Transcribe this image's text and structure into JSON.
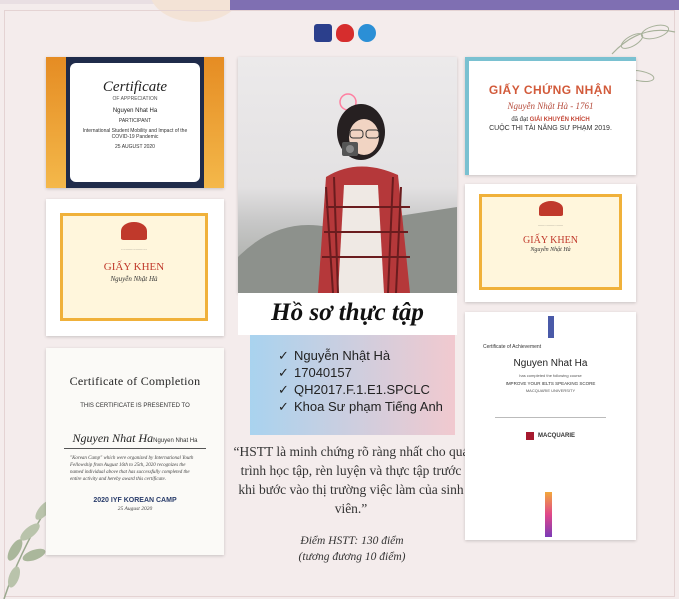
{
  "colors": {
    "accent": "#7f6fb2",
    "page_bg": "#f4ecec",
    "red_text": "#c0392b",
    "border_gold": "#f0b13a"
  },
  "header_logos": [
    "university-logo",
    "youth-union-logo",
    "students-association-logo"
  ],
  "cert_top_left": {
    "title": "Certificate",
    "subtitle": "OF APPRECIATION",
    "recipient": "Nguyen Nhat Ha",
    "role": "PARTICIPANT",
    "event": "International Student Mobility and Impact of the COVID-19 Pandemic",
    "date": "25 AUGUST 2020"
  },
  "giay_khen_left": {
    "title": "GIẤY KHEN",
    "recipient": "Nguyễn Nhật Hà"
  },
  "cert_completion": {
    "title": "Certificate of Completion",
    "presented": "THIS CERTIFICATE IS PRESENTED TO",
    "signature": "Nguyen Nhat Ha",
    "recipient_name": "Nguyen Nhat Ha",
    "body": "\"Korean Camp\" which were organized by International Youth Fellowship from August 16th to 25th, 2020 recognizes the named individual above that has successfully completed the entire activity and hereby award this certificate.",
    "program": "2020 IYF KOREAN CAMP",
    "date": "25 August 2020"
  },
  "profile": {
    "title": "Hồ sơ thực tập",
    "items": [
      "Nguyễn Nhật Hà",
      "17040157",
      "QH2017.F.1.E1.SPCLC",
      "Khoa Sư phạm Tiếng Anh"
    ],
    "check_symbol": "✓"
  },
  "quote": {
    "text": "“HSTT là minh chứng rõ ràng nhất cho quá trình học tập, rèn luyện và thực tập trước khi bước vào thị trường việc làm của sinh viên.”"
  },
  "score": {
    "line1": "Điểm HSTT: 130 điểm",
    "line2": "(tương đương 10 điểm)"
  },
  "cert_top_right": {
    "title": "GIẤY CHỨNG NHẬN",
    "recipient": "Nguyễn Nhật Hà - 1761",
    "award_prefix": "đã đạt",
    "award": "GIẢI KHUYẾN KHÍCH",
    "contest": "CUỘC THI TÀI NĂNG SƯ PHẠM 2019."
  },
  "giay_khen_right": {
    "title": "GIẤY KHEN",
    "recipient": "Nguyễn Nhật Hà"
  },
  "cert_achievement": {
    "label": "Certificate of Achievement",
    "recipient": "Nguyen Nhat Ha",
    "line1": "has completed the following course",
    "course": "IMPROVE YOUR IELTS SPEAKING SCORE",
    "university": "MACQUARIE UNIVERSITY",
    "logo_text": "MACQUARIE"
  }
}
